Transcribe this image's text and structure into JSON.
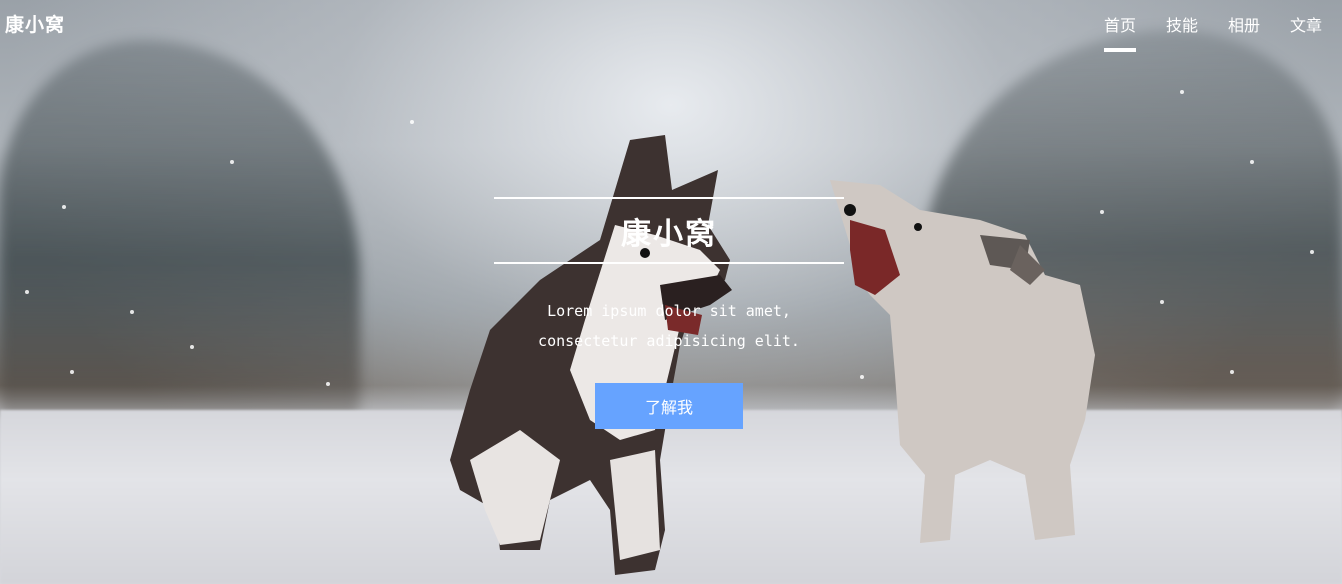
{
  "header": {
    "brand": "康小窝",
    "nav": [
      {
        "label": "首页",
        "active": true
      },
      {
        "label": "技能",
        "active": false
      },
      {
        "label": "相册",
        "active": false
      },
      {
        "label": "文章",
        "active": false
      }
    ]
  },
  "hero": {
    "title": "康小窝",
    "subtitle_line1": "Lorem ipsum dolor sit amet,",
    "subtitle_line2": "consectetur adipisicing elit.",
    "button_label": "了解我",
    "button_color": "#66a3ff"
  }
}
